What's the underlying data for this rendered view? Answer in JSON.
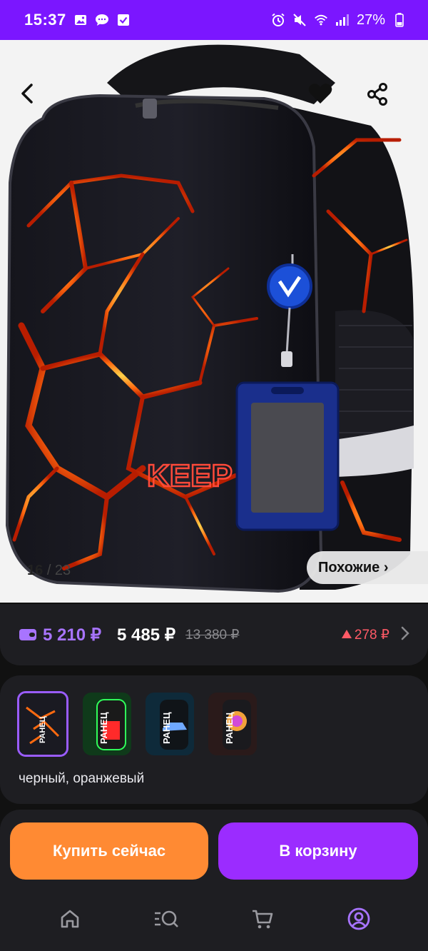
{
  "status_bar": {
    "time": "15:37",
    "battery": "27%",
    "left_icons": [
      "image-icon",
      "chat-icon",
      "check-icon"
    ],
    "right_icons": [
      "alarm-icon",
      "mute-icon",
      "wifi-icon",
      "signal-icon",
      "battery-icon"
    ]
  },
  "gallery": {
    "current": "16",
    "total": "/ 23",
    "similar_label": "Похожие ›",
    "product_text": "KEEP OUT"
  },
  "price": {
    "wallet_price": "5 210 ₽",
    "price": "5 485 ₽",
    "old_price": "13 380 ₽",
    "change": "278 ₽"
  },
  "variants": {
    "selected_label": "черный, оранжевый",
    "thumbnail_text": [
      "РАНЕЦ",
      "РАНЕЦ",
      "РАНЕЦ",
      "РАНЕЦ"
    ]
  },
  "actions": {
    "buy_now": "Купить сейчас",
    "add_to_cart": "В корзину"
  },
  "nav": {
    "items": [
      "home-icon",
      "catalog-search-icon",
      "cart-icon",
      "profile-icon"
    ]
  },
  "colors": {
    "status_bar": "#7b16ff",
    "accent_purple": "#9b2cff",
    "accent_orange": "#ff8a33",
    "wallet_price": "#a874ff",
    "price_up": "#ff5a66"
  }
}
